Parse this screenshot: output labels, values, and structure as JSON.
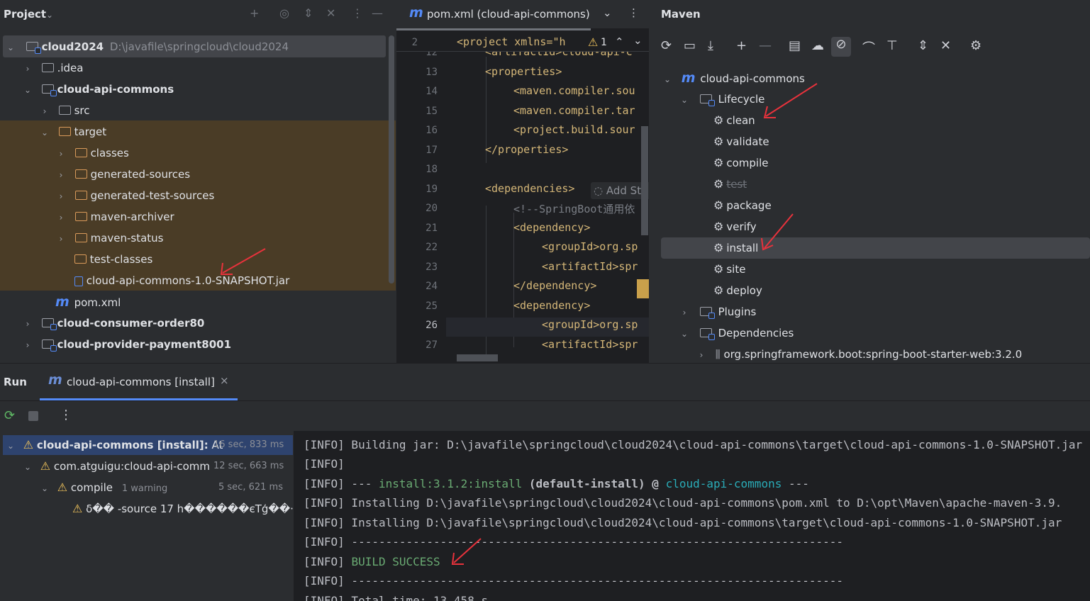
{
  "project": {
    "title": "Project",
    "root": {
      "name": "cloud2024",
      "path": "D:\\javafile\\springcloud\\cloud2024"
    },
    "items": [
      {
        "label": ".idea"
      },
      {
        "label": "cloud-api-commons"
      },
      {
        "label": "src"
      },
      {
        "label": "target"
      },
      {
        "label": "classes"
      },
      {
        "label": "generated-sources"
      },
      {
        "label": "generated-test-sources"
      },
      {
        "label": "maven-archiver"
      },
      {
        "label": "maven-status"
      },
      {
        "label": "test-classes"
      },
      {
        "label": "cloud-api-commons-1.0-SNAPSHOT.jar"
      },
      {
        "label": "pom.xml"
      },
      {
        "label": "cloud-consumer-order80"
      },
      {
        "label": "cloud-provider-payment8001"
      }
    ]
  },
  "editor": {
    "tab_label": "pom.xml (cloud-api-commons)",
    "sticky_line": "2",
    "sticky_code": "<project xmlns=\"h",
    "warning_count": "1",
    "hint": "Add Sta",
    "lines": [
      {
        "n": "12",
        "code": "<artifactId>cloud-api-c"
      },
      {
        "n": "13",
        "code": "<properties>"
      },
      {
        "n": "14",
        "code": "<maven.compiler.sou"
      },
      {
        "n": "15",
        "code": "<maven.compiler.tar"
      },
      {
        "n": "16",
        "code": "<project.build.sour"
      },
      {
        "n": "17",
        "code": "</properties>"
      },
      {
        "n": "18",
        "code": ""
      },
      {
        "n": "19",
        "code": "<dependencies>"
      },
      {
        "n": "20",
        "code": "<!--SpringBoot通用依"
      },
      {
        "n": "21",
        "code": "<dependency>"
      },
      {
        "n": "22",
        "code": "<groupId>org.sp"
      },
      {
        "n": "23",
        "code": "<artifactId>spr"
      },
      {
        "n": "24",
        "code": "</dependency>"
      },
      {
        "n": "25",
        "code": "<dependency>"
      },
      {
        "n": "26",
        "code": "<groupId>org.sp"
      },
      {
        "n": "27",
        "code": "<artifactId>spr"
      }
    ]
  },
  "maven": {
    "title": "Maven",
    "project": "cloud-api-commons",
    "lifecycle_label": "Lifecycle",
    "phases": [
      "clean",
      "validate",
      "compile",
      "test",
      "package",
      "verify",
      "install",
      "site",
      "deploy"
    ],
    "plugins_label": "Plugins",
    "dependencies_label": "Dependencies",
    "dependency_item": "org.springframework.boot:spring-boot-starter-web:3.2.0"
  },
  "run": {
    "title": "Run",
    "tab_label": "cloud-api-commons [install]",
    "tree": [
      {
        "label": "cloud-api-commons [install]:",
        "suffix": "At",
        "time": "16 sec, 833 ms"
      },
      {
        "label": "com.atguigu:cloud-api-comm",
        "time": "12 sec, 663 ms"
      },
      {
        "label": "compile",
        "suffix": "1 warning",
        "time": "5 sec, 621 ms"
      },
      {
        "label": "δ�� -source 17 h������єТģ��·"
      }
    ],
    "console": [
      "[INFO] Building jar: D:\\javafile\\springcloud\\cloud2024\\cloud-api-commons\\target\\cloud-api-commons-1.0-SNAPSHOT.jar",
      "[INFO]",
      "[INFO] --- ",
      "[INFO] Installing D:\\javafile\\springcloud\\cloud2024\\cloud-api-commons\\pom.xml to D:\\opt\\Maven\\apache-maven-3.9.",
      "[INFO] Installing D:\\javafile\\springcloud\\cloud2024\\cloud-api-commons\\target\\cloud-api-commons-1.0-SNAPSHOT.jar",
      "[INFO] ------------------------------------------------------------------------",
      "[INFO] ",
      "[INFO] ------------------------------------------------------------------------",
      "[INFO] Total time:  13.458 s"
    ],
    "install_goal": "install:3.1.2:install",
    "default_install": "(default-install) @",
    "artifact": "cloud-api-commons",
    "dashes_end": "---",
    "build_status": "BUILD SUCCESS"
  }
}
